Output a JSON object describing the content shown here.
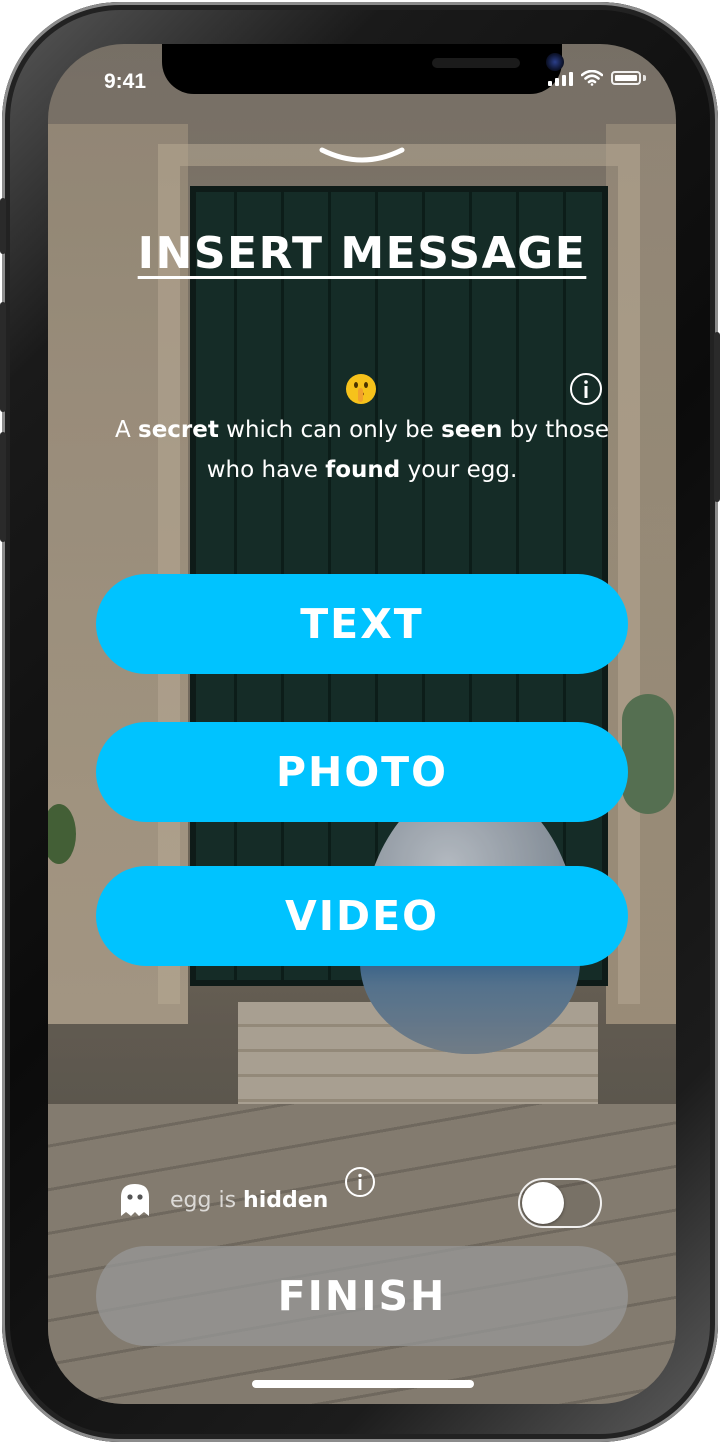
{
  "status": {
    "time": "9:41"
  },
  "header": {
    "title": "INSERT MESSAGE"
  },
  "description": {
    "segments": [
      "A ",
      "secret",
      " which can only be ",
      "seen",
      " by those who have ",
      "found",
      " your egg."
    ]
  },
  "options": {
    "text_label": "TEXT",
    "photo_label": "PHOTO",
    "video_label": "VIDEO"
  },
  "visibility": {
    "prefix": "egg is ",
    "state": "hidden",
    "toggle_on": false
  },
  "footer": {
    "finish_label": "FINISH"
  },
  "colors": {
    "accent": "#00c3ff",
    "finish_bg": "#969696"
  },
  "icons": [
    "chevron-down-icon",
    "shushing-face-emoji",
    "info-icon",
    "ghost-icon"
  ]
}
